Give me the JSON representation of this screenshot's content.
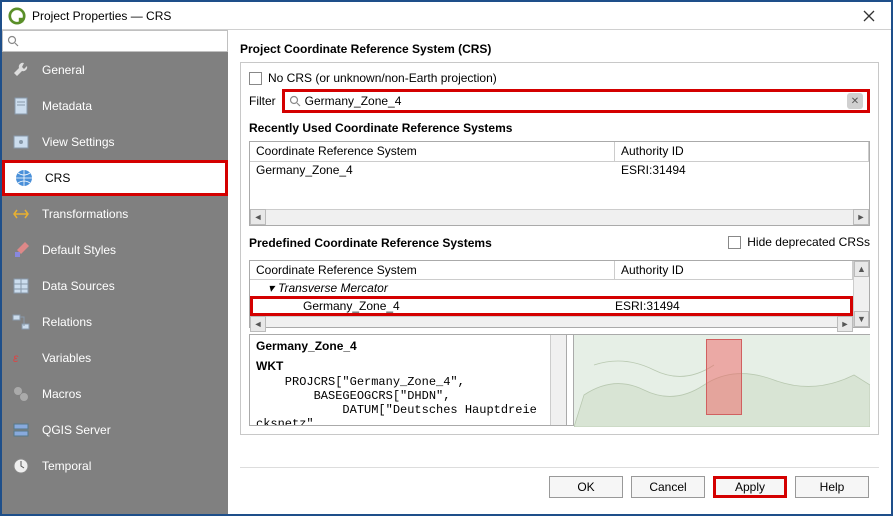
{
  "titlebar": {
    "title": "Project Properties — CRS"
  },
  "sidebar": {
    "search_placeholder": "",
    "items": [
      {
        "label": "General",
        "icon": "wrench"
      },
      {
        "label": "Metadata",
        "icon": "doc"
      },
      {
        "label": "View Settings",
        "icon": "eye"
      },
      {
        "label": "CRS",
        "icon": "globe",
        "selected": true
      },
      {
        "label": "Transformations",
        "icon": "arrows"
      },
      {
        "label": "Default Styles",
        "icon": "brush"
      },
      {
        "label": "Data Sources",
        "icon": "table"
      },
      {
        "label": "Relations",
        "icon": "rel"
      },
      {
        "label": "Variables",
        "icon": "eps"
      },
      {
        "label": "Macros",
        "icon": "gears"
      },
      {
        "label": "QGIS Server",
        "icon": "server"
      },
      {
        "label": "Temporal",
        "icon": "clock"
      }
    ]
  },
  "main": {
    "title": "Project Coordinate Reference System (CRS)",
    "no_crs_label": "No CRS (or unknown/non-Earth projection)",
    "filter_label": "Filter",
    "filter_value": "Germany_Zone_4",
    "recent_title": "Recently Used Coordinate Reference Systems",
    "col_crs": "Coordinate Reference System",
    "col_auth": "Authority ID",
    "recent_rows": [
      {
        "crs": "Germany_Zone_4",
        "auth": "ESRI:31494"
      }
    ],
    "predef_title": "Predefined Coordinate Reference Systems",
    "hide_deprecated": "Hide deprecated CRSs",
    "predef_group": "Transverse Mercator",
    "predef_leaf": {
      "crs": "Germany_Zone_4",
      "auth": "ESRI:31494"
    },
    "detail": {
      "name": "Germany_Zone_4",
      "wkt_label": "WKT",
      "wkt_lines": "    PROJCRS[\"Germany_Zone_4\",\n        BASEGEOGCRS[\"DHDN\",\n            DATUM[\"Deutsches Hauptdreie\ncksnetz\""
    },
    "buttons": {
      "ok": "OK",
      "cancel": "Cancel",
      "apply": "Apply",
      "help": "Help"
    }
  }
}
